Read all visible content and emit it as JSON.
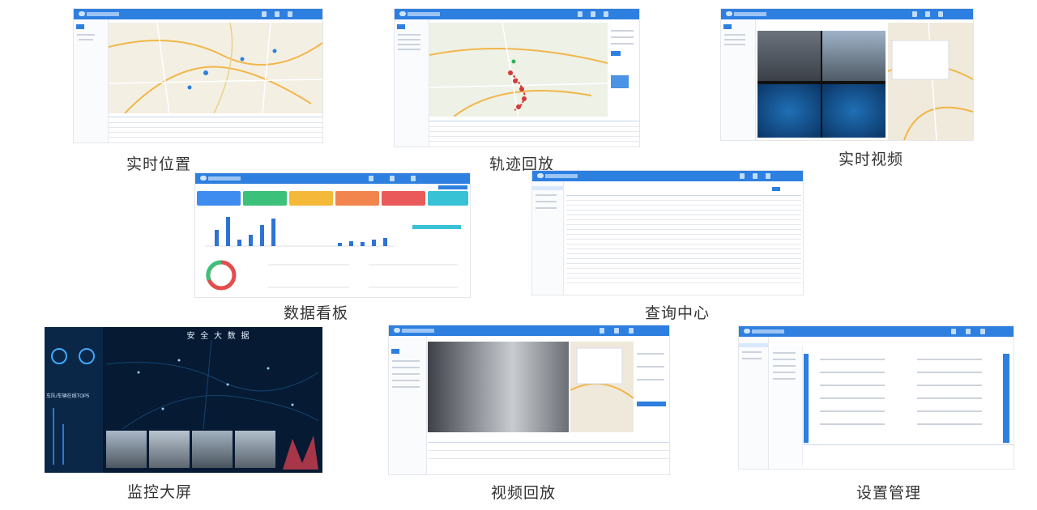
{
  "captions": {
    "realtime_location": "实时位置",
    "track_playback": "轨迹回放",
    "realtime_video": "实时视频",
    "data_board": "数据看板",
    "query_center": "查询中心",
    "monitor_screen": "监控大屏",
    "video_playback": "视频回放",
    "settings_manage": "设置管理"
  },
  "monitor_screen": {
    "title": "安 全 大 数 据",
    "panel_label": "车队/车辆在线TOP5"
  },
  "colors": {
    "topbar": "#2d7fe0",
    "kpi": [
      "#3f8cf0",
      "#3cc17a",
      "#f5b93a",
      "#f2844e",
      "#ea5a5a",
      "#38c2d6"
    ],
    "bars": "#2d73d6",
    "track": "#d23b3b"
  }
}
